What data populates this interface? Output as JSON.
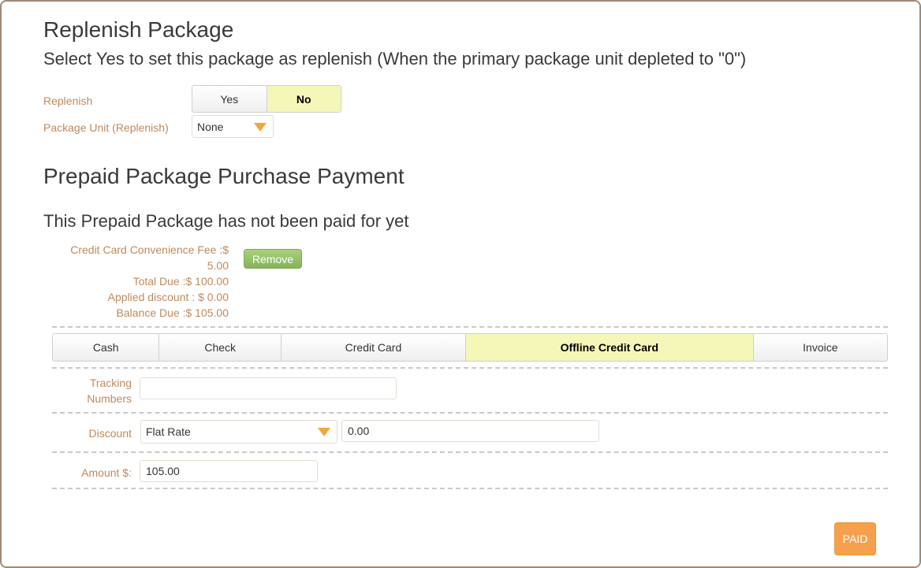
{
  "replenish_section": {
    "title": "Replenish Package",
    "subtitle": "Select Yes to set this package as replenish (When the primary package unit depleted to \"0\")",
    "replenish_label": "Replenish",
    "yes_label": "Yes",
    "no_label": "No",
    "selected": "No",
    "package_unit_label": "Package Unit (Replenish)",
    "package_unit_value": "None"
  },
  "payment_section": {
    "title": "Prepaid Package Purchase Payment",
    "status_message": "This Prepaid Package has not been paid for yet",
    "fee_line1": "Credit Card Convenience Fee :$",
    "fee_line2": "5.00",
    "total_due": "Total Due :$ 100.00",
    "applied_discount": "Applied discount : $ 0.00",
    "balance_due": "Balance Due :$ 105.00",
    "remove_label": "Remove",
    "methods": [
      "Cash",
      "Check",
      "Credit Card",
      "Offline Credit Card",
      "Invoice"
    ],
    "selected_method": "Offline Credit Card",
    "tracking_label_line1": "Tracking",
    "tracking_label_line2": "Numbers",
    "tracking_value": "",
    "discount_label": "Discount",
    "discount_type": "Flat Rate",
    "discount_value": "0.00",
    "amount_label": "Amount $:",
    "amount_value": "105.00",
    "paid_label": "PAID"
  },
  "colors": {
    "label": "#c08a5e",
    "active_option": "#f5f7b9",
    "remove_button": "#8fbb62",
    "paid_button": "#f5a04c",
    "caret": "#f3a63b"
  }
}
